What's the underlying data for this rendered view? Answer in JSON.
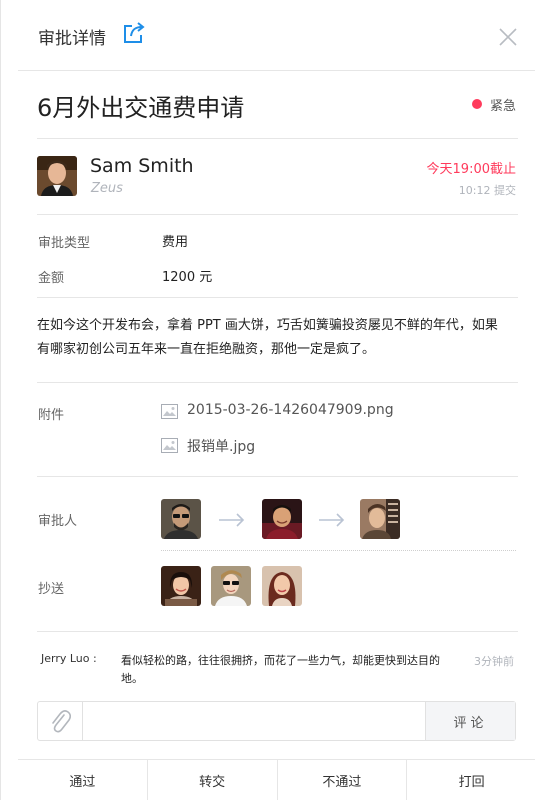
{
  "header": {
    "title": "审批详情",
    "share_icon": "share-icon",
    "close_icon": "close-icon"
  },
  "request": {
    "title": "6月外出交通费申请",
    "priority": "紧急",
    "priority_color": "#ff3b5c"
  },
  "applicant": {
    "name": "Sam Smith",
    "org": "Zeus",
    "deadline": "今天19:00截止",
    "submitted": "10:12 提交"
  },
  "fields": [
    {
      "label": "审批类型",
      "value": "费用"
    },
    {
      "label": "金额",
      "value": "1200 元"
    }
  ],
  "description": "在如今这个开发布会，拿着 PPT 画大饼，巧舌如簧骗投资屡见不鲜的年代，如果有哪家初创公司五年来一直在拒绝融资，那他一定是疯了。",
  "attachments": {
    "label": "附件",
    "files": [
      "2015-03-26-1426047909.png",
      "报销单.jpg"
    ]
  },
  "approvers": {
    "label": "审批人"
  },
  "cc": {
    "label": "抄送"
  },
  "comment": {
    "author": "Jerry Luo :",
    "text": "看似轻松的路，往往很拥挤，而花了一些力气，却能更快到达目的地。",
    "time": "3分钟前"
  },
  "comment_box": {
    "placeholder": "",
    "button": "评论"
  },
  "actions": [
    "通过",
    "转交",
    "不通过",
    "打回"
  ]
}
